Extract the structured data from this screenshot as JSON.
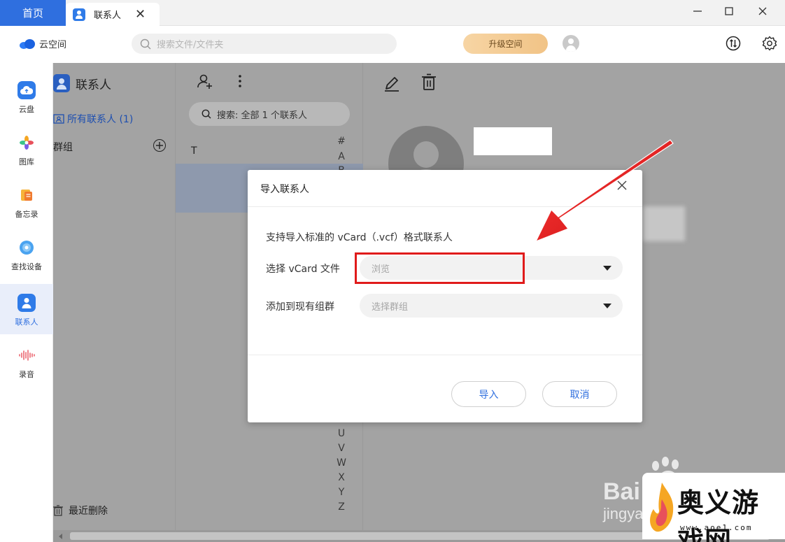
{
  "titlebar": {
    "home_tab": "首页",
    "contact_tab": "联系人",
    "tab_close": "✕",
    "minimize": "—",
    "maximize": "☐",
    "close": "✕"
  },
  "header": {
    "brand": "云空间",
    "search_placeholder": "搜索文件/文件夹",
    "upgrade": "升级空间"
  },
  "leftnav": {
    "items": [
      {
        "label": "云盘",
        "icon": "cloud-drive-icon"
      },
      {
        "label": "图库",
        "icon": "gallery-icon"
      },
      {
        "label": "备忘录",
        "icon": "notes-icon"
      },
      {
        "label": "查找设备",
        "icon": "find-device-icon"
      },
      {
        "label": "联系人",
        "icon": "contacts-icon"
      },
      {
        "label": "录音",
        "icon": "recorder-icon"
      }
    ],
    "active_index": 4
  },
  "contacts_panel": {
    "title": "联系人",
    "all_contacts": "所有联系人 (1)",
    "groups": "群组",
    "recently_deleted": "最近删除"
  },
  "list_panel": {
    "search": "搜索: 全部 1 个联系人",
    "section_letter": "T",
    "alphabet_top": [
      "#",
      "A",
      "B"
    ],
    "alphabet_bottom": [
      "U",
      "V",
      "W",
      "X",
      "Y",
      "Z"
    ]
  },
  "dialog": {
    "title": "导入联系人",
    "close": "✕",
    "description": "支持导入标准的 vCard（.vcf）格式联系人",
    "file_label": "选择 vCard 文件",
    "file_placeholder": "浏览",
    "group_label": "添加到现有组群",
    "group_placeholder": "选择群组",
    "import_button": "导入",
    "cancel_button": "取消"
  },
  "watermarks": {
    "baidu": "Bai",
    "baidu_sub": "jingya",
    "site_name": "奥义游戏网",
    "site_url": "www.aoe1.com"
  },
  "colors": {
    "accent": "#2f6fdf",
    "annotation": "#e01b1b",
    "overlay": "#a3a3a3"
  }
}
